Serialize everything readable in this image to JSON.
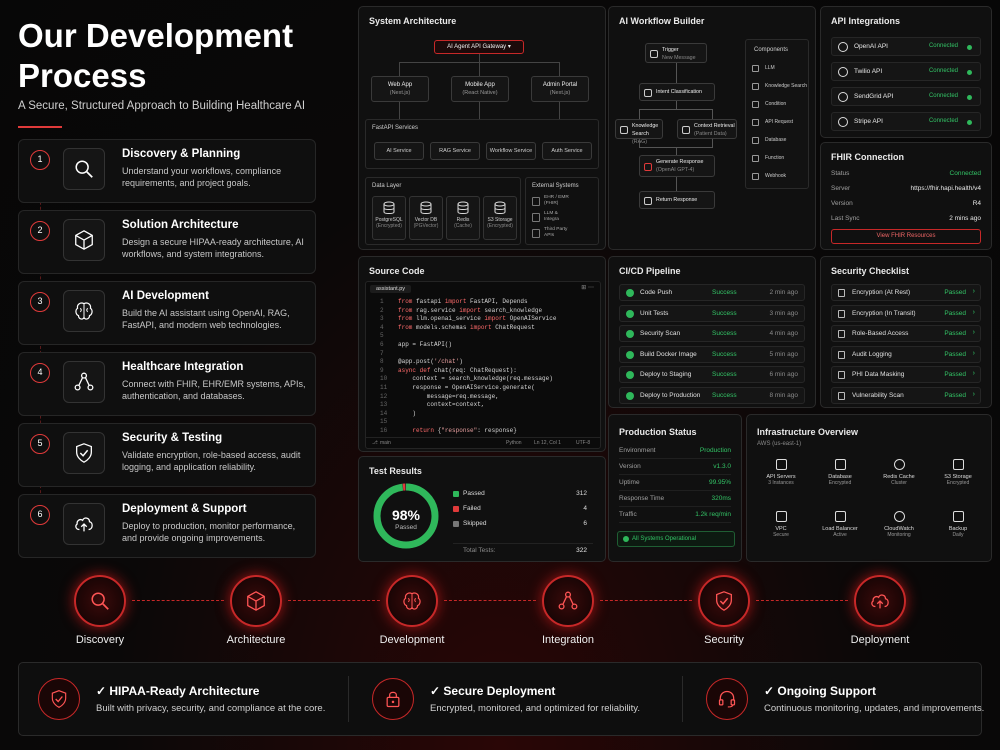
{
  "hero": {
    "title": "Our Development Process",
    "subtitle": "A Secure, Structured Approach to Building Healthcare AI"
  },
  "steps": [
    {
      "num": "1",
      "title": "Discovery & Planning",
      "desc": "Understand your workflows, compliance requirements, and project goals.",
      "icon": "search-icon"
    },
    {
      "num": "2",
      "title": "Solution Architecture",
      "desc": "Design a secure HIPAA-ready architecture, AI workflows, and system integrations.",
      "icon": "cube-icon"
    },
    {
      "num": "3",
      "title": "AI Development",
      "desc": "Build the AI assistant using OpenAI, RAG, FastAPI, and modern web technologies.",
      "icon": "brain-icon"
    },
    {
      "num": "4",
      "title": "Healthcare Integration",
      "desc": "Connect with FHIR, EHR/EMR systems, APIs, authentication, and databases.",
      "icon": "network-icon"
    },
    {
      "num": "5",
      "title": "Security & Testing",
      "desc": "Validate encryption, role-based access, audit logging, and application reliability.",
      "icon": "shield-check-icon"
    },
    {
      "num": "6",
      "title": "Deployment & Support",
      "desc": "Deploy to production, monitor performance, and provide ongoing improvements.",
      "icon": "cloud-upload-icon"
    }
  ],
  "arch": {
    "title": "System Architecture",
    "gateway": "AI Agent API Gateway",
    "clients": [
      {
        "name": "Web App",
        "sub": "(Next.js)"
      },
      {
        "name": "Mobile App",
        "sub": "(React Native)"
      },
      {
        "name": "Admin Portal",
        "sub": "(Next.js)"
      }
    ],
    "services_label": "FastAPI Services",
    "services": [
      "AI Service",
      "RAG Service",
      "Workflow Service",
      "Auth Service"
    ],
    "data_label": "Data Layer",
    "data": [
      {
        "name": "PostgreSQL",
        "sub": "(Encrypted)"
      },
      {
        "name": "Vector DB",
        "sub": "(PGVector)"
      },
      {
        "name": "Redis",
        "sub": "(Cache)"
      },
      {
        "name": "S3 Storage",
        "sub": "(Encrypted)"
      }
    ],
    "external_label": "External Systems",
    "external": [
      {
        "name": "EHR / EMR",
        "sub": "(FHIR)"
      },
      {
        "name": "LLM &",
        "sub": "Integra"
      },
      {
        "name": "Third Party",
        "sub": "APIs"
      }
    ]
  },
  "workflow": {
    "title": "AI Workflow Builder",
    "trigger": {
      "name": "Trigger",
      "sub": "New Message"
    },
    "intent": "Intent Classification",
    "knowledge": {
      "name": "Knowledge Search",
      "sub": "(RAG)"
    },
    "context": {
      "name": "Context Retrieval",
      "sub": "(Patient Data)"
    },
    "generate": {
      "name": "Generate Response",
      "sub": "(OpenAI GPT-4)"
    },
    "return": "Return Response",
    "components_label": "Components",
    "components": [
      "LLM",
      "Knowledge Search",
      "Condition",
      "API Request",
      "Database",
      "Function",
      "Webhook"
    ]
  },
  "api": {
    "title": "API Integrations",
    "items": [
      {
        "name": "OpenAI API",
        "status": "Connected"
      },
      {
        "name": "Twilio API",
        "status": "Connected"
      },
      {
        "name": "SendGrid API",
        "status": "Connected"
      },
      {
        "name": "Stripe API",
        "status": "Connected"
      }
    ]
  },
  "fhir": {
    "title": "FHIR Connection",
    "rows": [
      {
        "k": "Status",
        "v": "Connected"
      },
      {
        "k": "Server",
        "v": "https://fhir.hapi.health/v4"
      },
      {
        "k": "Version",
        "v": "R4"
      },
      {
        "k": "Last Sync",
        "v": "2 mins ago"
      }
    ],
    "button": "View FHIR Resources"
  },
  "source": {
    "title": "Source Code",
    "tab": "assistant.py",
    "lines": [
      {
        "n": "1",
        "t": "from fastapi import FastAPI, Depends"
      },
      {
        "n": "2",
        "t": "from rag.service import search_knowledge"
      },
      {
        "n": "3",
        "t": "from llm.openai_service import OpenAIService"
      },
      {
        "n": "4",
        "t": "from models.schemas import ChatRequest"
      },
      {
        "n": "5",
        "t": ""
      },
      {
        "n": "6",
        "t": "app = FastAPI()"
      },
      {
        "n": "7",
        "t": ""
      },
      {
        "n": "8",
        "t": "@app.post('/chat')"
      },
      {
        "n": "9",
        "t": "async def chat(req: ChatRequest):"
      },
      {
        "n": "10",
        "t": "    context = search_knowledge(req.message)"
      },
      {
        "n": "11",
        "t": "    response = OpenAIService.generate("
      },
      {
        "n": "12",
        "t": "        message=req.message,"
      },
      {
        "n": "13",
        "t": "        context=context,"
      },
      {
        "n": "14",
        "t": "    )"
      },
      {
        "n": "15",
        "t": ""
      },
      {
        "n": "16",
        "t": "    return {\"response\": response}"
      }
    ],
    "status_left": "main",
    "status_lang": "Python",
    "status_pos": "Ln 12, Col 1",
    "status_enc": "UTF-8"
  },
  "cicd": {
    "title": "CI/CD Pipeline",
    "items": [
      {
        "name": "Code Push",
        "status": "Success",
        "time": "2 min ago"
      },
      {
        "name": "Unit Tests",
        "status": "Success",
        "time": "3 min ago"
      },
      {
        "name": "Security Scan",
        "status": "Success",
        "time": "4 min ago"
      },
      {
        "name": "Build Docker Image",
        "status": "Success",
        "time": "5 min ago"
      },
      {
        "name": "Deploy to Staging",
        "status": "Success",
        "time": "6 min ago"
      },
      {
        "name": "Deploy to Production",
        "status": "Success",
        "time": "8 min ago"
      }
    ]
  },
  "security": {
    "title": "Security Checklist",
    "items": [
      {
        "name": "Encryption (At Rest)",
        "status": "Passed"
      },
      {
        "name": "Encryption (In Transit)",
        "status": "Passed"
      },
      {
        "name": "Role-Based Access",
        "status": "Passed"
      },
      {
        "name": "Audit Logging",
        "status": "Passed"
      },
      {
        "name": "PHI Data Masking",
        "status": "Passed"
      },
      {
        "name": "Vulnerability Scan",
        "status": "Passed"
      }
    ]
  },
  "tests": {
    "title": "Test Results",
    "percent": "98%",
    "percent_label": "Passed",
    "pass_fraction": 0.98,
    "rows": [
      {
        "name": "Passed",
        "count": "312",
        "color": "#2fb85b"
      },
      {
        "name": "Failed",
        "count": "4",
        "color": "#e03a3a"
      },
      {
        "name": "Skipped",
        "count": "6",
        "color": "#777777"
      }
    ],
    "total_label": "Total Tests:",
    "total": "322"
  },
  "production": {
    "title": "Production Status",
    "rows": [
      {
        "k": "Environment",
        "v": "Production"
      },
      {
        "k": "Version",
        "v": "v1.3.0"
      },
      {
        "k": "Uptime",
        "v": "99.95%"
      },
      {
        "k": "Response Time",
        "v": "320ms"
      },
      {
        "k": "Traffic",
        "v": "1.2k req/min"
      }
    ],
    "status": "All Systems Operational"
  },
  "infra": {
    "title": "Infrastructure Overview",
    "region": "AWS (us-east-1)",
    "items": [
      {
        "name": "API Servers",
        "sub": "3 Instances"
      },
      {
        "name": "Database",
        "sub": "Encrypted"
      },
      {
        "name": "Redis Cache",
        "sub": "Cluster"
      },
      {
        "name": "S3 Storage",
        "sub": "Encrypted"
      },
      {
        "name": "VPC",
        "sub": "Secure"
      },
      {
        "name": "Load Balancer",
        "sub": "Active"
      },
      {
        "name": "CloudWatch",
        "sub": "Monitoring"
      },
      {
        "name": "Backup",
        "sub": "Daily"
      }
    ]
  },
  "timeline": [
    "Discovery",
    "Architecture",
    "Development",
    "Integration",
    "Security",
    "Deployment"
  ],
  "bottom": [
    {
      "title": "✓ HIPAA-Ready Architecture",
      "desc": "Built with privacy, security, and compliance at the core."
    },
    {
      "title": "✓ Secure Deployment",
      "desc": "Encrypted, monitored, and optimized for reliability."
    },
    {
      "title": "✓ Ongoing Support",
      "desc": "Continuous monitoring, updates, and improvements."
    }
  ],
  "colors": {
    "accent": "#e03a3a",
    "success": "#2fb85b",
    "panel": "#101010"
  }
}
